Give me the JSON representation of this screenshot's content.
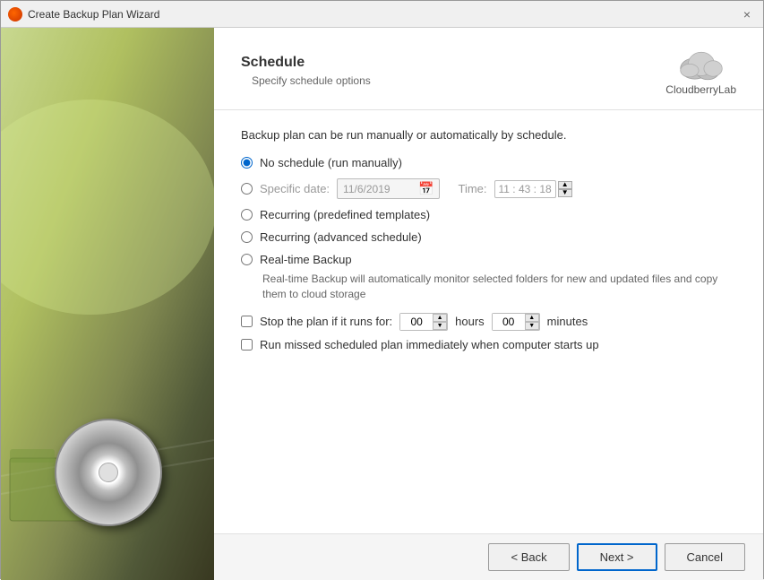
{
  "titleBar": {
    "title": "Create Backup Plan Wizard",
    "closeButton": "×"
  },
  "header": {
    "title": "Schedule",
    "subtitle": "Specify schedule options",
    "logoText": "CloudberryLab"
  },
  "form": {
    "description": "Backup plan can be run manually or automatically by schedule.",
    "options": [
      {
        "id": "no-schedule",
        "label": "No schedule (run manually)",
        "selected": true
      },
      {
        "id": "specific-date",
        "label": "Specific date:",
        "selected": false
      },
      {
        "id": "recurring-predefined",
        "label": "Recurring (predefined templates)",
        "selected": false
      },
      {
        "id": "recurring-advanced",
        "label": "Recurring (advanced schedule)",
        "selected": false
      },
      {
        "id": "realtime",
        "label": "Real-time Backup",
        "selected": false
      }
    ],
    "dateField": {
      "value": "11/6/2019",
      "placeholder": "11/6/2019"
    },
    "timeLabel": "Time:",
    "timeValue": "11 : 43 : 18",
    "realtimeNote": "Real-time Backup will automatically monitor selected folders for new and updated files and copy them to cloud storage",
    "stopPlan": {
      "label": "Stop the plan if it runs for:",
      "hoursValue": "00",
      "hoursLabel": "hours",
      "minutesValue": "00",
      "minutesLabel": "minutes"
    },
    "missedPlan": {
      "label": "Run missed scheduled plan immediately when computer starts up"
    }
  },
  "footer": {
    "backButton": "< Back",
    "nextButton": "Next >",
    "cancelButton": "Cancel"
  }
}
